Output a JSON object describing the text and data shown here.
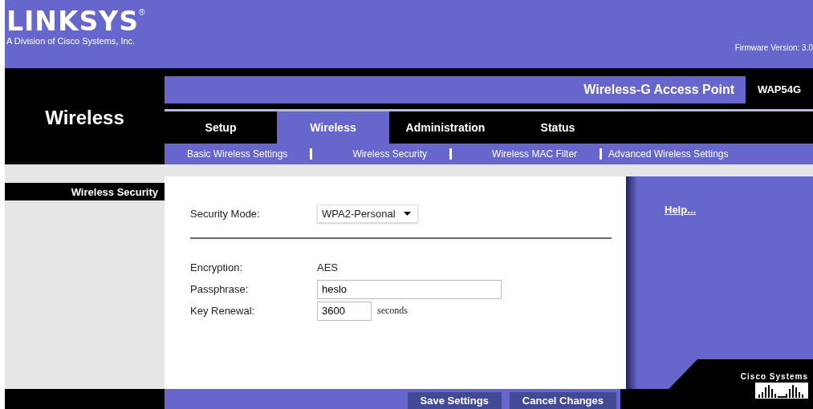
{
  "brand": {
    "logo": "LINKSYS",
    "registered": "®",
    "tagline": "A Division of Cisco Systems, Inc.",
    "firmware": "Firmware Version: 3.0"
  },
  "section_title": "Wireless",
  "product": {
    "name": "Wireless-G Access Point",
    "model": "WAP54G"
  },
  "tabs": [
    {
      "label": "Setup",
      "selected": false
    },
    {
      "label": "Wireless",
      "selected": true
    },
    {
      "label": "Administration",
      "selected": false
    },
    {
      "label": "Status",
      "selected": false
    }
  ],
  "subtabs": [
    {
      "label": "Basic Wireless Settings"
    },
    {
      "label": "Wireless Security"
    },
    {
      "label": "Wireless MAC Filter"
    },
    {
      "label": "Advanced Wireless Settings"
    }
  ],
  "sidebar": {
    "heading": "Wireless Security"
  },
  "form": {
    "security_mode": {
      "label": "Security Mode:",
      "value": "WPA2-Personal"
    },
    "encryption": {
      "label": "Encryption:",
      "value": "AES"
    },
    "passphrase": {
      "label": "Passphrase:",
      "value": "heslo"
    },
    "key_renewal": {
      "label": "Key Renewal:",
      "value": "3600",
      "unit": "seconds"
    }
  },
  "help": {
    "link": "Help..."
  },
  "buttons": [
    "Save Settings",
    "Cancel Changes"
  ],
  "footer_logo": "Cisco Systems"
}
